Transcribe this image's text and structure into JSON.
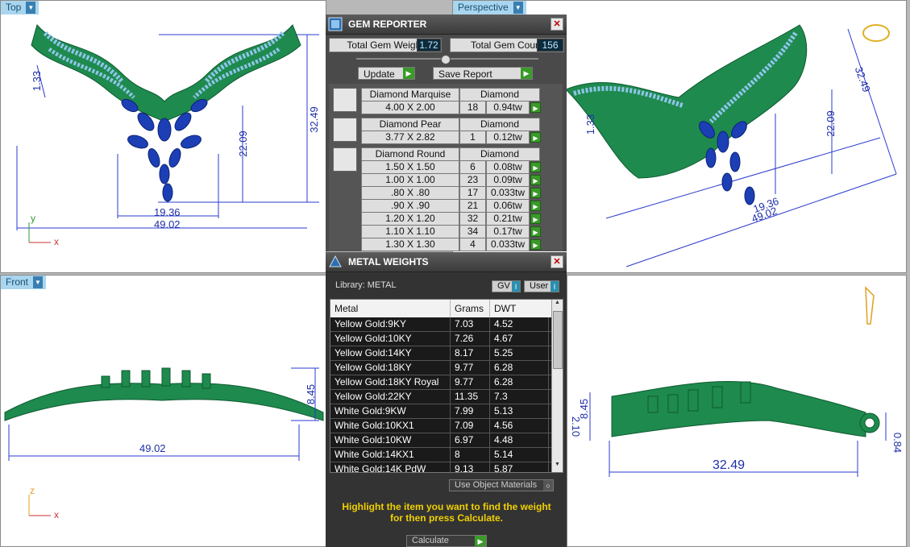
{
  "viewports": {
    "top": {
      "label": "Top",
      "dims": [
        "1.33",
        "32.49",
        "22.09",
        "19.36",
        "49.02"
      ],
      "axis_y": "y",
      "axis_x": "x"
    },
    "perspective": {
      "label": "Perspective",
      "dims": [
        "32.49",
        "22.09",
        "1.33",
        "49.02",
        "19.36"
      ]
    },
    "front": {
      "label": "Front",
      "dims": [
        "8.45",
        "49.02"
      ],
      "axis_y": "z",
      "axis_x": "x"
    },
    "right": {
      "dims": [
        "8.45",
        "2.10",
        "0.84",
        "32.49"
      ]
    }
  },
  "gem_reporter": {
    "title": "GEM REPORTER",
    "total_weight_label": "Total Gem Weight",
    "total_weight_value": "1.72",
    "total_count_label": "Total Gem Count",
    "total_count_value": "156",
    "update_label": "Update",
    "save_report_label": "Save Report",
    "groups": [
      {
        "name": "Diamond Marquise",
        "material": "Diamond",
        "rows": [
          {
            "size": "4.00 X 2.00",
            "count": "18",
            "weight": "0.94tw"
          }
        ]
      },
      {
        "name": "Diamond Pear",
        "material": "Diamond",
        "rows": [
          {
            "size": "3.77 X 2.82",
            "count": "1",
            "weight": "0.12tw"
          }
        ]
      },
      {
        "name": "Diamond Round",
        "material": "Diamond",
        "rows": [
          {
            "size": "1.50 X 1.50",
            "count": "6",
            "weight": "0.08tw"
          },
          {
            "size": "1.00 X 1.00",
            "count": "23",
            "weight": "0.09tw"
          },
          {
            "size": ".80 X .80",
            "count": "17",
            "weight": "0.033tw"
          },
          {
            "size": ".90 X .90",
            "count": "21",
            "weight": "0.06tw"
          },
          {
            "size": "1.20 X 1.20",
            "count": "32",
            "weight": "0.21tw"
          },
          {
            "size": "1.10 X 1.10",
            "count": "34",
            "weight": "0.17tw"
          },
          {
            "size": "1.30 X 1.30",
            "count": "4",
            "weight": "0.033tw"
          }
        ]
      }
    ]
  },
  "metal_weights": {
    "title": "METAL WEIGHTS",
    "library_label": "Library: METAL",
    "gv_label": "GV",
    "user_label": "User",
    "headers": [
      "Metal",
      "Grams",
      "DWT"
    ],
    "rows": [
      [
        "Yellow Gold:9KY",
        "7.03",
        "4.52"
      ],
      [
        "Yellow Gold:10KY",
        "7.26",
        "4.67"
      ],
      [
        "Yellow Gold:14KY",
        "8.17",
        "5.25"
      ],
      [
        "Yellow Gold:18KY",
        "9.77",
        "6.28"
      ],
      [
        "Yellow Gold:18KY Royal",
        "9.77",
        "6.28"
      ],
      [
        "Yellow Gold:22KY",
        "11.35",
        "7.3"
      ],
      [
        "White Gold:9KW",
        "7.99",
        "5.13"
      ],
      [
        "White Gold:10KX1",
        "7.09",
        "4.56"
      ],
      [
        "White Gold:10KW",
        "6.97",
        "4.48"
      ],
      [
        "White Gold:14KX1",
        "8",
        "5.14"
      ],
      [
        "White Gold:14K PdW",
        "9.13",
        "5.87"
      ]
    ],
    "use_object_materials": "Use Object Materials",
    "instruction": "Highlight the item you want to find the weight for then press Calculate.",
    "calculate_label": "Calculate"
  }
}
